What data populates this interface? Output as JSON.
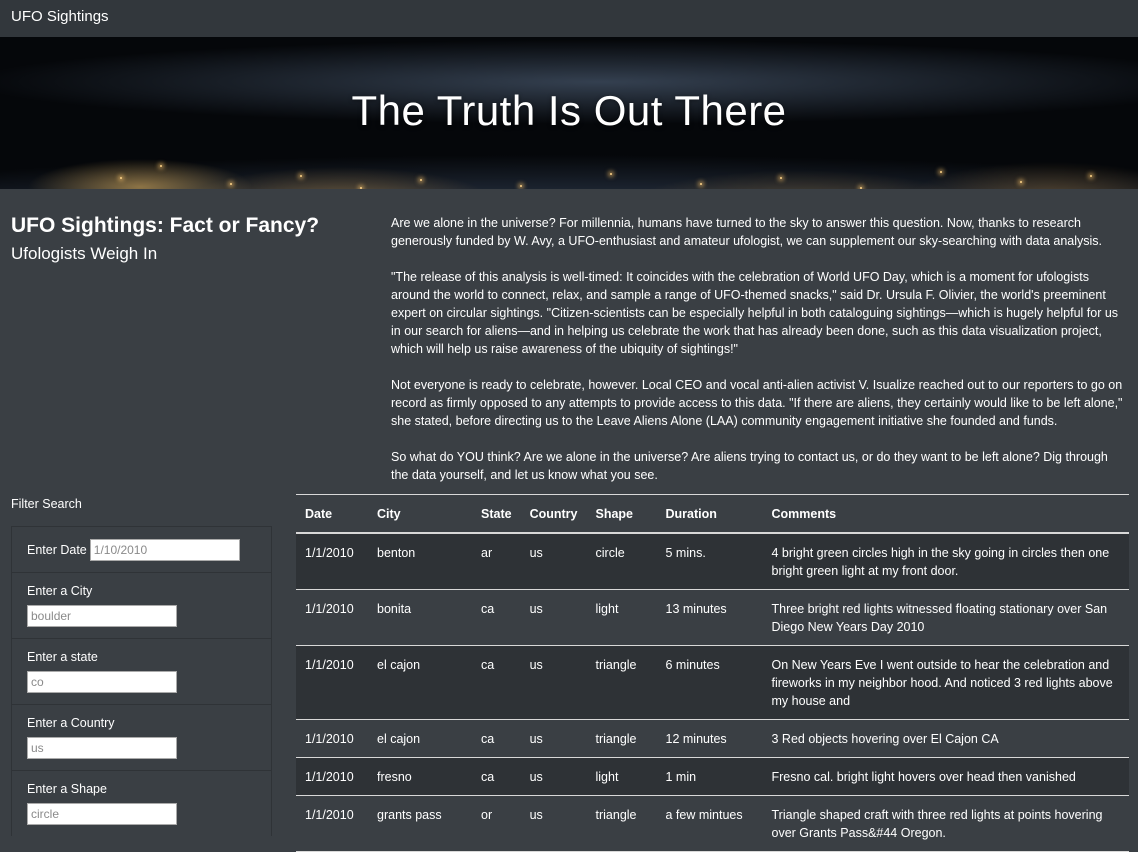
{
  "navbar": {
    "brand": "UFO Sightings"
  },
  "hero": {
    "title": "The Truth Is Out There"
  },
  "intro": {
    "title": "UFO Sightings: Fact or Fancy?",
    "subtitle": "Ufologists Weigh In"
  },
  "article": {
    "paragraphs": [
      "Are we alone in the universe? For millennia, humans have turned to the sky to answer this question. Now, thanks to research generously funded by W. Avy, a UFO-enthusiast and amateur ufologist, we can supplement our sky-searching with data analysis.",
      "\"The release of this analysis is well-timed: It coincides with the celebration of World UFO Day, which is a moment for ufologists around the world to connect, relax, and sample a range of UFO-themed snacks,\" said Dr. Ursula F. Olivier, the world's preeminent expert on circular sightings. \"Citizen-scientists can be especially helpful in both cataloguing sightings—which is hugely helpful for us in our search for aliens—and in helping us celebrate the work that has already been done, such as this data visualization project, which will help us raise awareness of the ubiquity of sightings!\"",
      "Not everyone is ready to celebrate, however. Local CEO and vocal anti-alien activist V. Isualize reached out to our reporters to go on record as firmly opposed to any attempts to provide access to this data. \"If there are aliens, they certainly would like to be left alone,\" she stated, before directing us to the Leave Aliens Alone (LAA) community engagement initiative she founded and funds.",
      "So what do YOU think? Are we alone in the universe? Are aliens trying to contact us, or do they want to be left alone? Dig through the data yourself, and let us know what you see."
    ]
  },
  "filters": {
    "heading": "Filter Search",
    "date": {
      "label": "Enter Date",
      "placeholder": "1/10/2010"
    },
    "city": {
      "label": "Enter a City",
      "placeholder": "boulder"
    },
    "state": {
      "label": "Enter a state",
      "placeholder": "co"
    },
    "country": {
      "label": "Enter a Country",
      "placeholder": "us"
    },
    "shape": {
      "label": "Enter a Shape",
      "placeholder": "circle"
    }
  },
  "table": {
    "headers": [
      "Date",
      "City",
      "State",
      "Country",
      "Shape",
      "Duration",
      "Comments"
    ],
    "rows": [
      [
        "1/1/2010",
        "benton",
        "ar",
        "us",
        "circle",
        "5 mins.",
        "4 bright green circles high in the sky going in circles then one bright green light at my front door."
      ],
      [
        "1/1/2010",
        "bonita",
        "ca",
        "us",
        "light",
        "13 minutes",
        "Three bright red lights witnessed floating stationary over San Diego New Years Day 2010"
      ],
      [
        "1/1/2010",
        "el cajon",
        "ca",
        "us",
        "triangle",
        "6 minutes",
        "On New Years Eve I went outside to hear the celebration and fireworks in my neighbor hood. And noticed 3 red lights above my house and"
      ],
      [
        "1/1/2010",
        "el cajon",
        "ca",
        "us",
        "triangle",
        "12 minutes",
        "3 Red objects hovering over El Cajon CA"
      ],
      [
        "1/1/2010",
        "fresno",
        "ca",
        "us",
        "light",
        "1 min",
        "Fresno cal. bright light hovers over head then vanished"
      ],
      [
        "1/1/2010",
        "grants pass",
        "or",
        "us",
        "triangle",
        "a few mintues",
        "Triangle shaped craft with three red lights at points hovering over Grants Pass&#44 Oregon."
      ]
    ]
  }
}
